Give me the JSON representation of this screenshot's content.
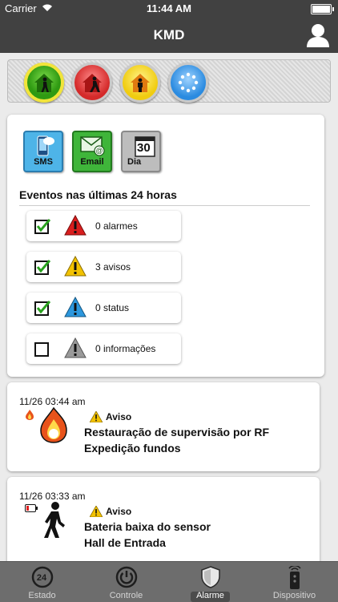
{
  "status_bar": {
    "carrier": "Carrier",
    "time": "11:44 AM"
  },
  "nav": {
    "title": "KMD",
    "user_icon": "user-icon"
  },
  "modes": [
    {
      "name": "home-mode",
      "color": "#2f9a12",
      "selected": true
    },
    {
      "name": "away-mode",
      "color": "#d42a2a",
      "selected": false
    },
    {
      "name": "stay-mode",
      "color": "#f0cc10",
      "selected": false
    },
    {
      "name": "loading-mode",
      "color": "#2b8be0",
      "selected": false
    }
  ],
  "notifications": {
    "sms_label": "SMS",
    "email_label": "Email",
    "dia_label": "Dia",
    "calendar_day": "30"
  },
  "summary": {
    "heading": "Eventos nas últimas 24 horas",
    "items": [
      {
        "text": "0 alarmes",
        "checked": true,
        "severity": "alarm",
        "color": "#d81e1e"
      },
      {
        "text": "3 avisos",
        "checked": true,
        "severity": "warning",
        "color": "#f2c200"
      },
      {
        "text": "0 status",
        "checked": true,
        "severity": "status",
        "color": "#2c97dd"
      },
      {
        "text": "0 informações",
        "checked": false,
        "severity": "info",
        "color": "#9a9a9a"
      }
    ]
  },
  "log": [
    {
      "time": "11/26 03:44 am",
      "type": "Aviso",
      "line1": "Restauração de supervisão por RF",
      "line2": "Expedição fundos",
      "icon": "fire-icon"
    },
    {
      "time": "11/26 03:33 am",
      "type": "Aviso",
      "line1": "Bateria baixa do sensor",
      "line2": "Hall de Entrada",
      "icon": "walking-person-icon"
    }
  ],
  "tabs": [
    {
      "label": "Estado",
      "icon": "24hr-icon",
      "active": false
    },
    {
      "label": "Controle",
      "icon": "power-icon",
      "active": false
    },
    {
      "label": "Alarme",
      "icon": "shield-icon",
      "active": true
    },
    {
      "label": "Dispositivo",
      "icon": "remote-icon",
      "active": false
    }
  ]
}
